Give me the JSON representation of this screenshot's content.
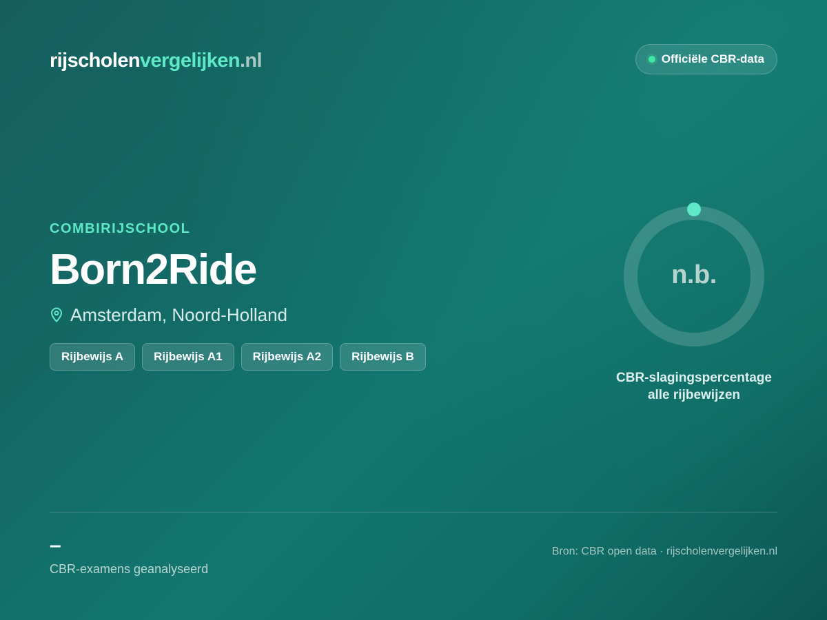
{
  "brand": {
    "logo_part1": "rijscholen",
    "logo_part2": "vergelijken",
    "logo_part3": ".nl",
    "accent_color": "#5ee8c6"
  },
  "badge": {
    "label": "Officiële CBR-data",
    "dot_color": "#3ee6a3",
    "icon": "status-dot-icon"
  },
  "school": {
    "category": "COMBIRIJSCHOOL",
    "name": "Born2Ride",
    "location": "Amsterdam, Noord-Holland",
    "location_icon": "map-pin-icon",
    "licenses": [
      "Rijbewijs A",
      "Rijbewijs A1",
      "Rijbewijs A2",
      "Rijbewijs B"
    ]
  },
  "pass_rate": {
    "value_text": "n.b.",
    "caption_line1": "CBR-slagingspercentage",
    "caption_line2": "alle rijbewijzen"
  },
  "footer": {
    "exams_count": "–",
    "exams_label": "CBR-examens geanalyseerd",
    "source": "Bron: CBR open data · rijscholenvergelijken.nl"
  }
}
